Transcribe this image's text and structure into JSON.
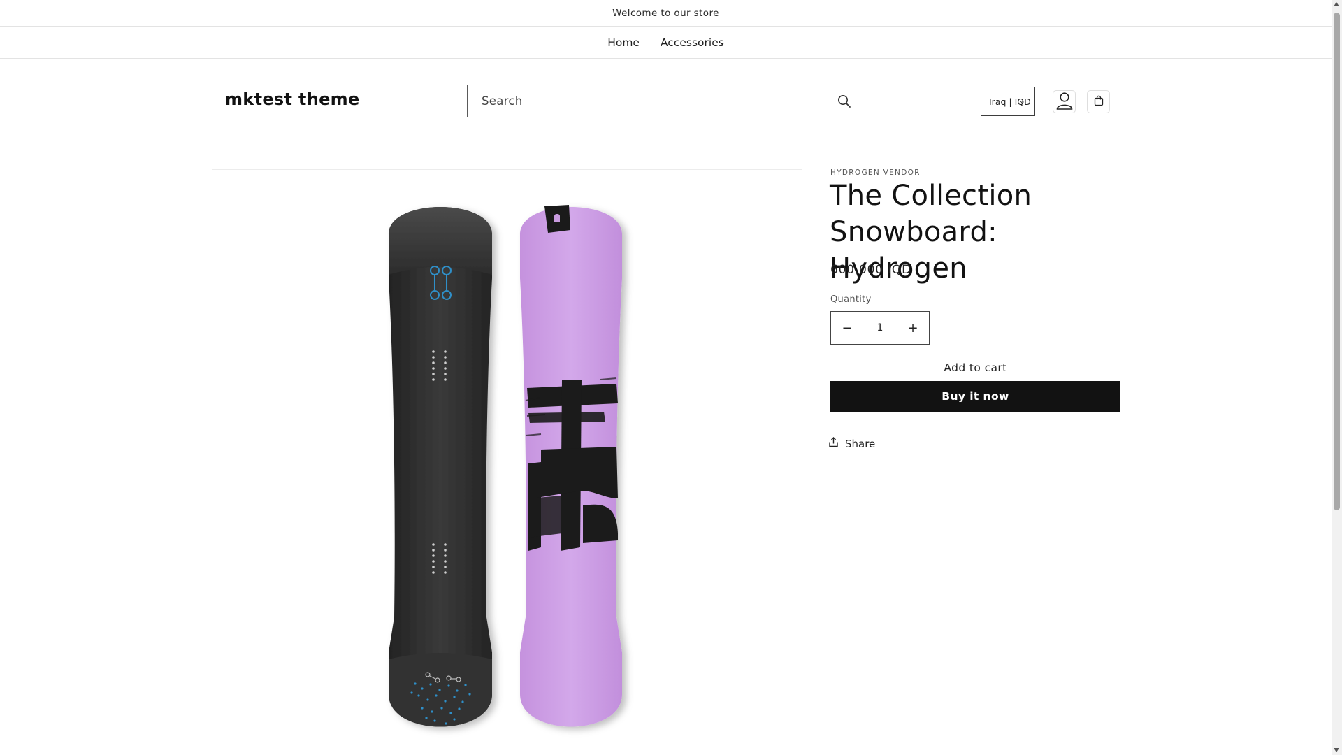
{
  "announcement": {
    "text": "Welcome to our store"
  },
  "nav": {
    "items": [
      {
        "label": "Home"
      },
      {
        "label": "Accessories"
      }
    ]
  },
  "header": {
    "logo": "mktest theme",
    "search": {
      "placeholder": "Search",
      "value": ""
    },
    "country_selector": {
      "value": "Iraq | IQD"
    }
  },
  "product": {
    "vendor": "HYDROGEN VENDOR",
    "title": "The Collection Snowboard: Hydrogen",
    "price": "600.000 IQD",
    "quantity_label": "Quantity",
    "quantity": "1",
    "decrease_symbol": "−",
    "increase_symbol": "+",
    "add_to_cart_label": "Add to cart",
    "buy_now_label": "Buy it now",
    "share_label": "Share"
  },
  "icons": {
    "search": "search-icon",
    "account": "account-icon",
    "cart": "cart-icon",
    "share": "share-icon",
    "chevron": "chevron-down-icon"
  },
  "colors": {
    "board_dark": "#2f2f2f",
    "board_purple": "#c99be0",
    "accent_blue": "#2f8fc8",
    "button_black": "#121212"
  }
}
